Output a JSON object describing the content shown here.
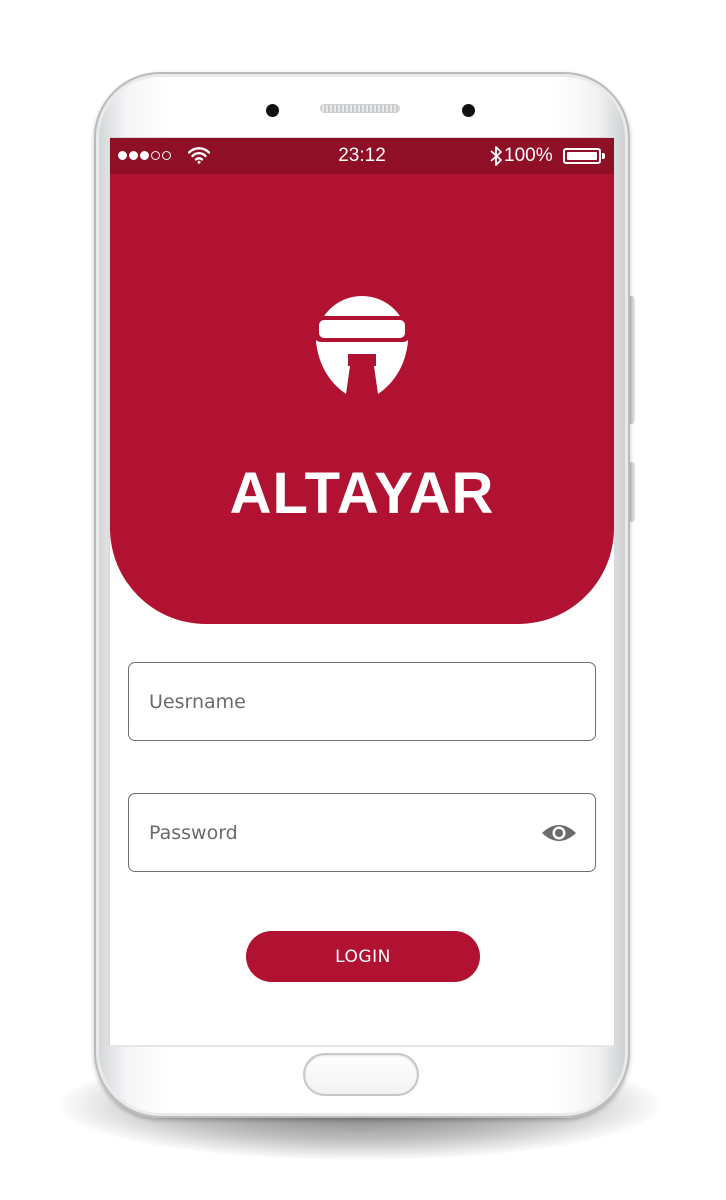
{
  "status_bar": {
    "time": "23:12",
    "battery_percent": "100%",
    "signal_bars_filled": 3,
    "signal_bars_total": 5,
    "wifi_icon": "wifi-icon",
    "bluetooth_icon": "bluetooth-icon",
    "battery_icon": "battery-icon"
  },
  "hero": {
    "logo_icon": "helmet-logo-icon",
    "brand_name": "ALTAYAR"
  },
  "login_form": {
    "username_placeholder": "Uesrname",
    "username_value": "",
    "password_placeholder": "Password",
    "password_value": "",
    "password_toggle_icon": "eye-icon",
    "submit_label": "LOGIN"
  },
  "colors": {
    "brand_red": "#b11231",
    "status_bar": "#8e0f26",
    "field_border": "#6f6f6f",
    "eye_icon": "#6b6b6b"
  }
}
